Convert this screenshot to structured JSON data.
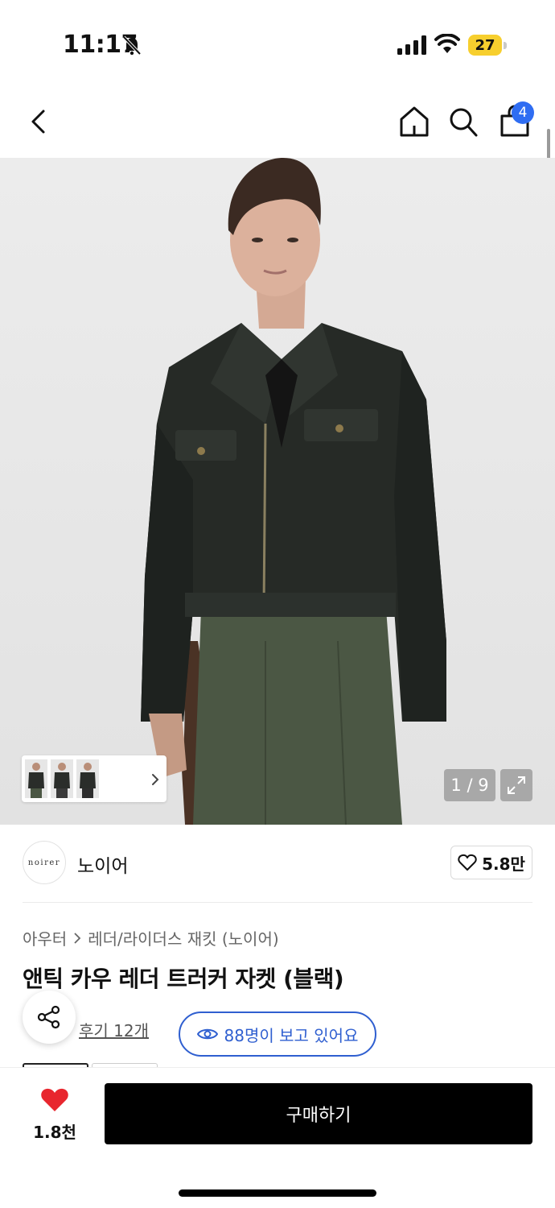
{
  "status_bar": {
    "time": "11:17",
    "battery": "27",
    "icons": [
      "bell-off-icon",
      "signal-icon",
      "wifi-icon",
      "battery-icon"
    ]
  },
  "header": {
    "icons": [
      "back-icon",
      "home-icon",
      "search-icon",
      "cart-icon"
    ],
    "cart_count": "4"
  },
  "gallery": {
    "counter": "1 / 9",
    "expand_icon": "expand-icon"
  },
  "brand": {
    "logo_text": "noirer",
    "name": "노이어",
    "likes": "5.8만"
  },
  "breadcrumb": {
    "items": [
      "아우터",
      "레더/라이더스 재킷 (노이어)"
    ]
  },
  "product": {
    "title": "앤틱 카우 레더 트러커 자켓 (블랙)",
    "review_link": "후기 12개",
    "viewers": "88명이 보고 있어요"
  },
  "bottom_bar": {
    "like_count": "1.8천",
    "buy_label": "구매하기"
  },
  "colors": {
    "accent_blue": "#2f6df2",
    "viewers_blue": "#2f5fd0",
    "heart_red": "#e8262e",
    "battery_yellow": "#f7cf2e"
  }
}
